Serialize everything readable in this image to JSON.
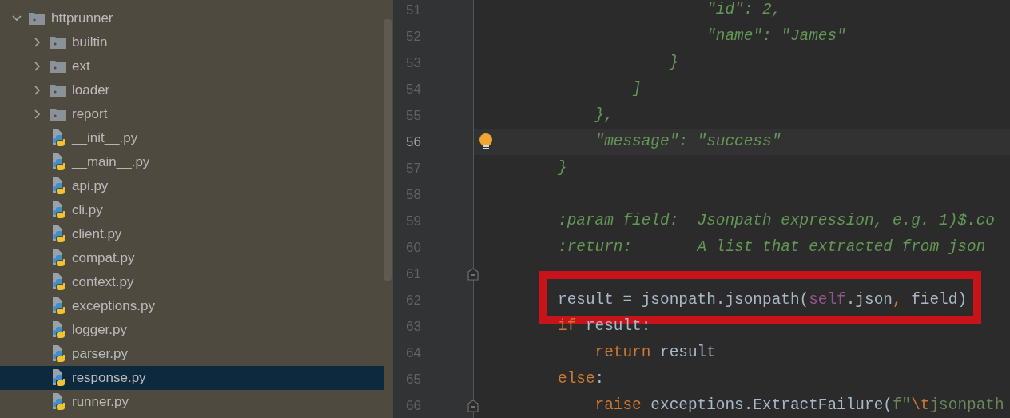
{
  "project_tree": {
    "items": [
      {
        "label": "httprunner",
        "kind": "folder",
        "expanded": true,
        "selected": false,
        "children": [
          {
            "label": "builtin",
            "kind": "folder",
            "expanded": false,
            "selected": false
          },
          {
            "label": "ext",
            "kind": "folder",
            "expanded": false,
            "selected": false
          },
          {
            "label": "loader",
            "kind": "folder",
            "expanded": false,
            "selected": false
          },
          {
            "label": "report",
            "kind": "folder",
            "expanded": false,
            "selected": false
          },
          {
            "label": "__init__.py",
            "kind": "file",
            "selected": false
          },
          {
            "label": "__main__.py",
            "kind": "file",
            "selected": false
          },
          {
            "label": "api.py",
            "kind": "file",
            "selected": false
          },
          {
            "label": "cli.py",
            "kind": "file",
            "selected": false
          },
          {
            "label": "client.py",
            "kind": "file",
            "selected": false
          },
          {
            "label": "compat.py",
            "kind": "file",
            "selected": false
          },
          {
            "label": "context.py",
            "kind": "file",
            "selected": false
          },
          {
            "label": "exceptions.py",
            "kind": "file",
            "selected": false
          },
          {
            "label": "logger.py",
            "kind": "file",
            "selected": false
          },
          {
            "label": "parser.py",
            "kind": "file",
            "selected": false
          },
          {
            "label": "response.py",
            "kind": "file",
            "selected": true
          },
          {
            "label": "runner.py",
            "kind": "file",
            "selected": false
          }
        ]
      }
    ]
  },
  "editor": {
    "lines": [
      {
        "number": "51",
        "current": false,
        "boxed": false,
        "bulb": false,
        "fold": false,
        "tokens": [
          {
            "text": "                \"id\": 2,",
            "kind": "doc"
          }
        ]
      },
      {
        "number": "52",
        "current": false,
        "boxed": false,
        "bulb": false,
        "fold": false,
        "tokens": [
          {
            "text": "                \"name\": \"James\"",
            "kind": "doc"
          }
        ]
      },
      {
        "number": "53",
        "current": false,
        "boxed": false,
        "bulb": false,
        "fold": false,
        "tokens": [
          {
            "text": "            }",
            "kind": "doc"
          }
        ]
      },
      {
        "number": "54",
        "current": false,
        "boxed": false,
        "bulb": false,
        "fold": false,
        "tokens": [
          {
            "text": "        ]",
            "kind": "doc"
          }
        ]
      },
      {
        "number": "55",
        "current": false,
        "boxed": false,
        "bulb": false,
        "fold": false,
        "tokens": [
          {
            "text": "    },",
            "kind": "doc"
          }
        ]
      },
      {
        "number": "56",
        "current": true,
        "boxed": false,
        "bulb": true,
        "fold": false,
        "tokens": [
          {
            "text": "    \"message\": \"success\"",
            "kind": "doc"
          }
        ]
      },
      {
        "number": "57",
        "current": false,
        "boxed": false,
        "bulb": false,
        "fold": false,
        "tokens": [
          {
            "text": "}",
            "kind": "doc"
          }
        ]
      },
      {
        "number": "58",
        "current": false,
        "boxed": false,
        "bulb": false,
        "fold": false
      },
      {
        "number": "59",
        "current": false,
        "boxed": false,
        "bulb": false,
        "fold": false,
        "tokens": [
          {
            "text": ":param field:  Jsonpath expression, e.g. 1)$.co",
            "kind": "doc"
          }
        ]
      },
      {
        "number": "60",
        "current": false,
        "boxed": false,
        "bulb": false,
        "fold": false,
        "tokens": [
          {
            "text": ":return:       A list that extracted from json",
            "kind": "doc"
          }
        ]
      },
      {
        "number": "61",
        "current": false,
        "boxed": false,
        "bulb": false,
        "fold": true
      },
      {
        "number": "62",
        "current": false,
        "boxed": true,
        "bulb": false,
        "fold": false,
        "tokens": [
          {
            "text": "result = jsonpath.jsonpath(",
            "kind": "plain"
          },
          {
            "text": "self",
            "kind": "self"
          },
          {
            "text": ".json",
            "kind": "plain"
          },
          {
            "text": ",",
            "kind": "keyword"
          },
          {
            "text": " field)",
            "kind": "plain"
          }
        ]
      },
      {
        "number": "63",
        "current": false,
        "boxed": false,
        "bulb": false,
        "fold": false,
        "tokens": [
          {
            "text": "if",
            "kind": "keyword"
          },
          {
            "text": " result:",
            "kind": "plain"
          }
        ]
      },
      {
        "number": "64",
        "current": false,
        "boxed": false,
        "bulb": false,
        "fold": false,
        "tokens": [
          {
            "text": "    return",
            "kind": "keyword"
          },
          {
            "text": " result",
            "kind": "plain"
          }
        ]
      },
      {
        "number": "65",
        "current": false,
        "boxed": false,
        "bulb": false,
        "fold": false,
        "tokens": [
          {
            "text": "else",
            "kind": "keyword"
          },
          {
            "text": ":",
            "kind": "plain"
          }
        ]
      },
      {
        "number": "66",
        "current": false,
        "boxed": false,
        "bulb": false,
        "fold": true,
        "tokens": [
          {
            "text": "    raise",
            "kind": "keyword"
          },
          {
            "text": " exceptions.ExtractFailure(",
            "kind": "plain"
          },
          {
            "text": "f\"",
            "kind": "string"
          },
          {
            "text": "\\t",
            "kind": "keyword"
          },
          {
            "text": "jsonpath",
            "kind": "string"
          }
        ]
      }
    ]
  }
}
